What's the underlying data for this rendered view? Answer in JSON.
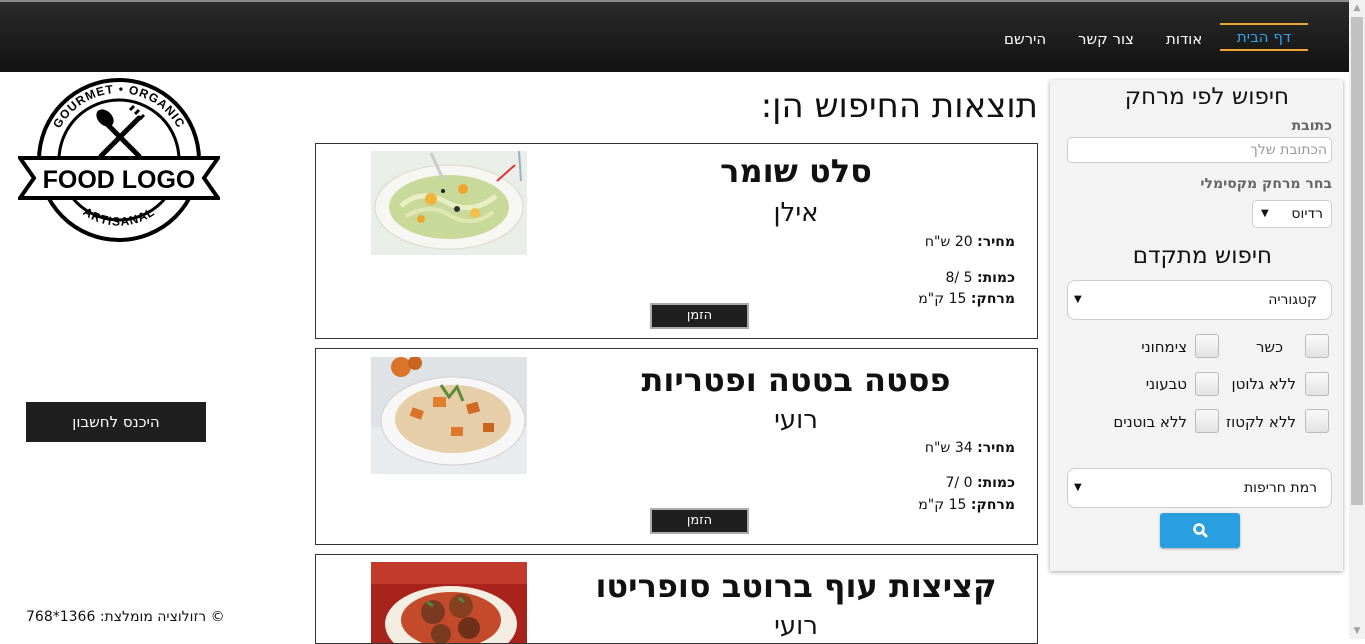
{
  "nav": {
    "items": [
      "דף הבית",
      "אודות",
      "צור קשר",
      "הירשם"
    ]
  },
  "logo": {
    "top_text": "GOURMET • ORGANIC",
    "center_text": "FOOD LOGO",
    "bottom_text": "ARTISANAL"
  },
  "account": {
    "login_label": "היכנס לחשבון"
  },
  "footer": {
    "text": "© רזולוציה מומלצת: 1366*768"
  },
  "results": {
    "title": "תוצאות החיפוש הן:",
    "price_label": "מחיר:",
    "quantity_label": "כמות:",
    "distance_label": "מרחק:",
    "order_label": "הזמן",
    "items": [
      {
        "name": "סלט שומר",
        "chef": "אילן",
        "price": "20 ש\"ח",
        "quantity": "5 /8",
        "distance": "15 ק\"מ"
      },
      {
        "name": "פסטה בטטה ופטריות",
        "chef": "רועי",
        "price": "34 ש\"ח",
        "quantity": "0 /7",
        "distance": "15 ק\"מ"
      },
      {
        "name": "קציצות עוף ברוטב סופריטו",
        "chef": "רועי"
      }
    ]
  },
  "sidebar": {
    "distance_title": "חיפוש לפי מרחק",
    "address_label": "כתובת",
    "address_placeholder": "הכתובת שלך",
    "max_distance_label": "בחר מרחק מקסימלי",
    "radius_value": "רדיוס",
    "advanced_title": "חיפוש מתקדם",
    "category_value": "קטגוריה",
    "checkboxes": [
      "כשר",
      "צימחוני",
      "ללא גלוטן",
      "טבעוני",
      "ללא לקטוז",
      "ללא בוטנים"
    ],
    "spiciness_value": "רמת חריפות",
    "search_icon": "search-icon"
  },
  "colors": {
    "accent_blue": "#2fa3e6",
    "accent_orange": "#f0a531",
    "search_button": "#2a9fdf"
  }
}
